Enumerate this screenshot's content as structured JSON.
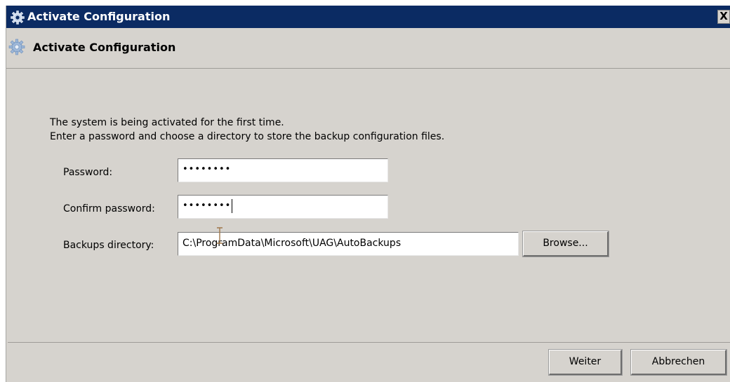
{
  "window": {
    "title": "Activate Configuration",
    "close_label": "X"
  },
  "header": {
    "title": "Activate Configuration"
  },
  "content": {
    "line1": "The system is being activated for the first time.",
    "line2": "Enter a password and choose a directory to store the backup configuration files.",
    "password_label": "Password:",
    "password_value": "••••••••",
    "confirm_label": "Confirm password:",
    "confirm_value": "••••••••",
    "backups_label": "Backups directory:",
    "backups_value": "C:\\ProgramData\\Microsoft\\UAG\\AutoBackups",
    "browse_label": "Browse..."
  },
  "footer": {
    "next_label": "Weiter",
    "cancel_label": "Abbrechen"
  },
  "colors": {
    "titlebar": "#0b2b63",
    "dialog_background": "#d6d3ce"
  },
  "icons": {
    "title": "gear-icon",
    "header": "gear-icon"
  }
}
